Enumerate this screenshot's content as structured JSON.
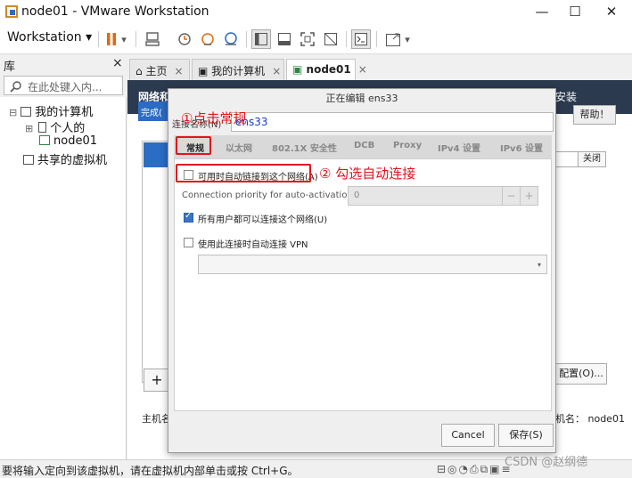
{
  "window": {
    "title": "node01 - VMware Workstation",
    "min": "—",
    "max": "☐",
    "close": "✕"
  },
  "toolbar": {
    "menu_label": "Workstation ▾",
    "pause_dropdown": "▾",
    "fullscreen_dropdown": "▾"
  },
  "library": {
    "title": "库",
    "close": "×",
    "search_placeholder": "在此处键入内...",
    "tree": [
      {
        "label": "我的计算机",
        "expander": "⊟"
      },
      {
        "label": "个人的",
        "expander": "⊞"
      },
      {
        "label": "node01"
      },
      {
        "label": "共享的虚拟机"
      }
    ]
  },
  "tabs": [
    {
      "label": "主页",
      "close": "×"
    },
    {
      "label": "我的计算机",
      "close": "×"
    },
    {
      "label": "node01",
      "close": "×"
    }
  ],
  "background_app": {
    "header": "网络和",
    "done_button": "完成(",
    "install_text": "安装",
    "help_button": "帮助！",
    "close_button": "关闭",
    "add_button": "+",
    "config_button": "配置(O)...",
    "host_label": "主机名",
    "hostname_label": "机名：",
    "hostname_value": "node01"
  },
  "dialog": {
    "title": "正在编辑 ens33",
    "conn_name_label": "连接名称(N)",
    "conn_name_value": "ens33",
    "subtabs": [
      "常规",
      "以太网",
      "802.1X 安全性",
      "DCB",
      "Proxy",
      "IPv4 设置",
      "IPv6 设置"
    ],
    "auto_connect_label": "可用时自动链接到这个网络(A)",
    "auto_connect_checked": false,
    "priority_label": "Connection priority for auto-activation:",
    "priority_value": "0",
    "priority_minus": "−",
    "priority_plus": "+",
    "all_users_label": "所有用户都可以连接这个网络(U)",
    "all_users_checked": true,
    "vpn_label": "使用此连接时自动连接 VPN",
    "vpn_checked": false,
    "vpn_select_arrow": "▾",
    "cancel_button": "Cancel",
    "save_button": "保存(S)"
  },
  "annotations": {
    "step1": "①点击常规",
    "step2": "② 勾选自动连接",
    "color": "#e0161b"
  },
  "statusbar": {
    "message": "要将输入定向到该虚拟机，请在虚拟机内部单击或按 Ctrl+G。",
    "icons": "⊟◎◔⎙⧉▣≡"
  },
  "watermark": "CSDN @赵纲德"
}
